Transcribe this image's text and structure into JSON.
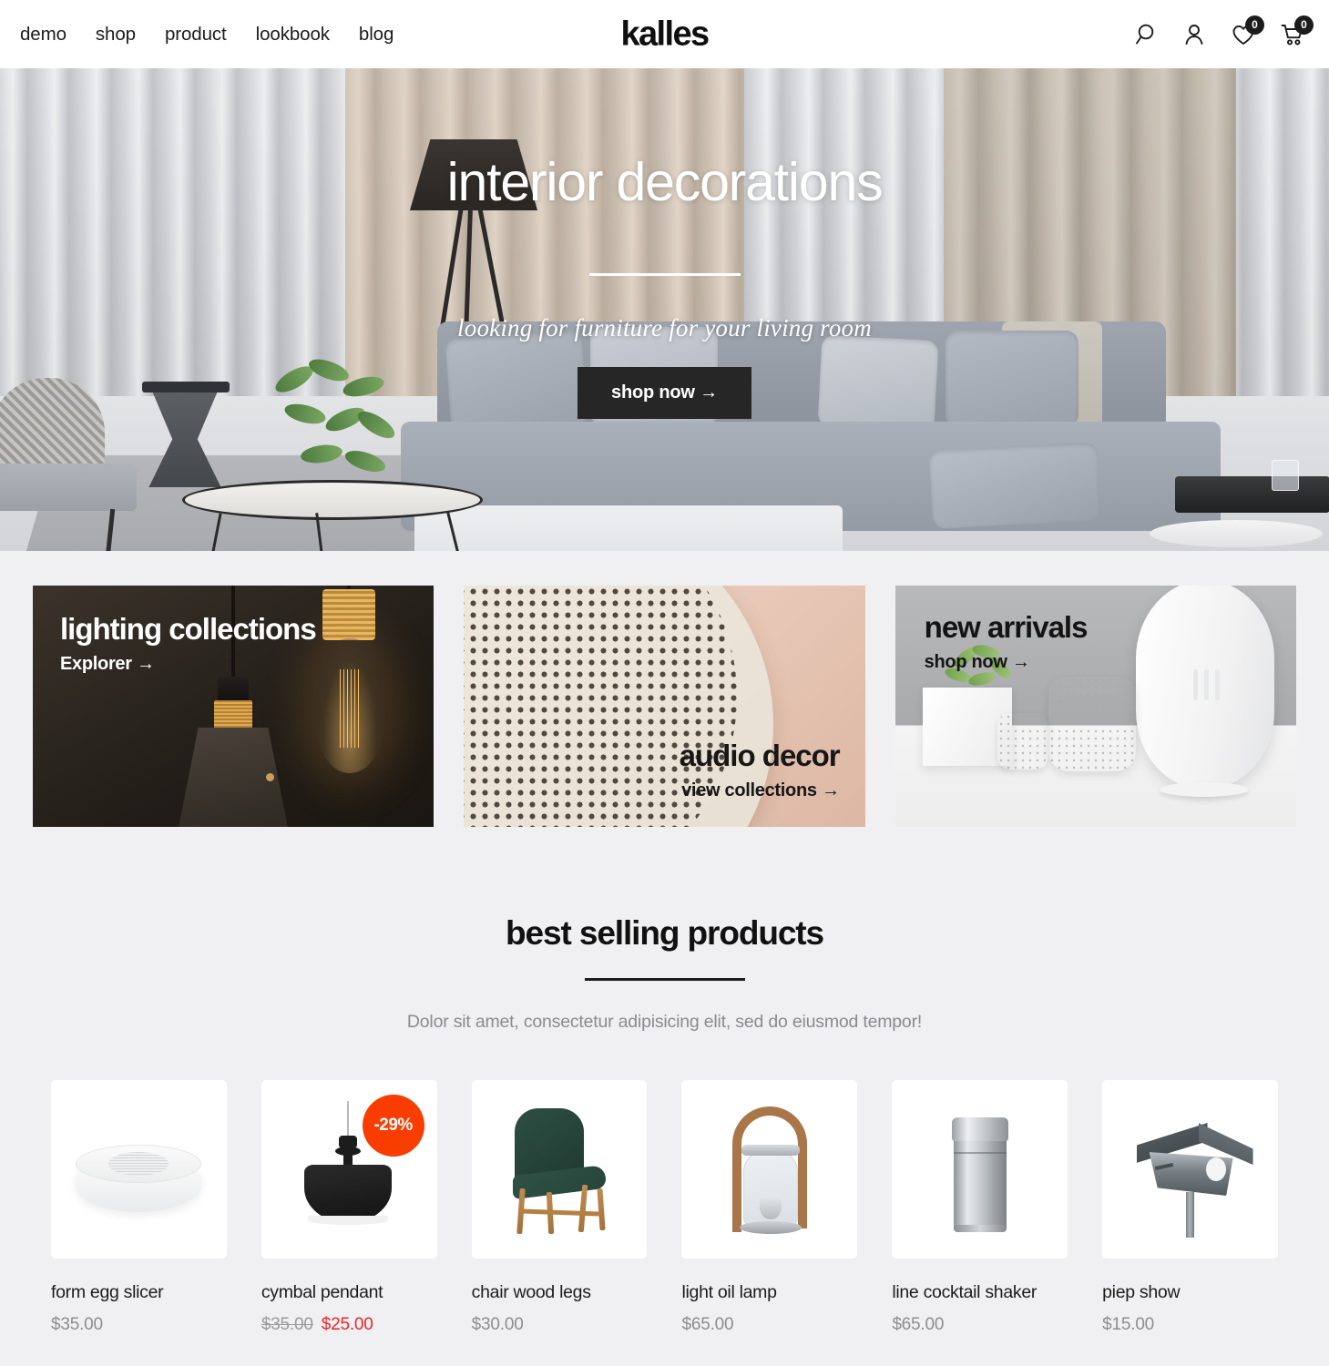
{
  "header": {
    "nav_items": [
      {
        "label": "demo"
      },
      {
        "label": "shop"
      },
      {
        "label": "product"
      },
      {
        "label": "lookbook"
      },
      {
        "label": "blog"
      }
    ],
    "logo": "kalles",
    "icons": {
      "search": "search-icon",
      "account": "user-icon",
      "wishlist": "heart-icon",
      "wishlist_count": "0",
      "cart": "cart-icon",
      "cart_count": "0"
    }
  },
  "hero": {
    "title": "interior decorations",
    "subtitle": "looking for furniture for your living room",
    "button_label": "shop now →"
  },
  "promos": [
    {
      "title": "lighting collections",
      "link_label": "Explorer →",
      "theme": "dark-brown",
      "accent": "#1a1611"
    },
    {
      "title": "audio decor",
      "link_label": "view collections →",
      "theme": "blush",
      "accent": "#e7c6b5"
    },
    {
      "title": "new arrivals",
      "link_label": "shop now →",
      "theme": "gray",
      "accent": "#a9aaac"
    }
  ],
  "best_selling": {
    "title": "best selling products",
    "subtitle": "Dolor sit amet, consectetur adipisicing elit, sed do eiusmod tempor!",
    "products": [
      {
        "name": "form egg slicer",
        "price": "$35.00",
        "old_price": "",
        "sale_price": "",
        "badge": ""
      },
      {
        "name": "cymbal pendant",
        "price": "",
        "old_price": "$35.00",
        "sale_price": "$25.00",
        "badge": "-29%"
      },
      {
        "name": "chair wood legs",
        "price": "$30.00",
        "old_price": "",
        "sale_price": "",
        "badge": ""
      },
      {
        "name": "light oil lamp",
        "price": "$65.00",
        "old_price": "",
        "sale_price": "",
        "badge": ""
      },
      {
        "name": "line cocktail shaker",
        "price": "$65.00",
        "old_price": "",
        "sale_price": "",
        "badge": ""
      },
      {
        "name": "piep show",
        "price": "$15.00",
        "old_price": "",
        "sale_price": "",
        "badge": ""
      }
    ]
  },
  "colors": {
    "page_background": "#f0f0f2",
    "text_primary": "#1c1c1c",
    "text_muted": "#8d8d90",
    "sale_red": "#e8262a",
    "badge_orange": "#f93d00",
    "button_dark": "#262626"
  }
}
